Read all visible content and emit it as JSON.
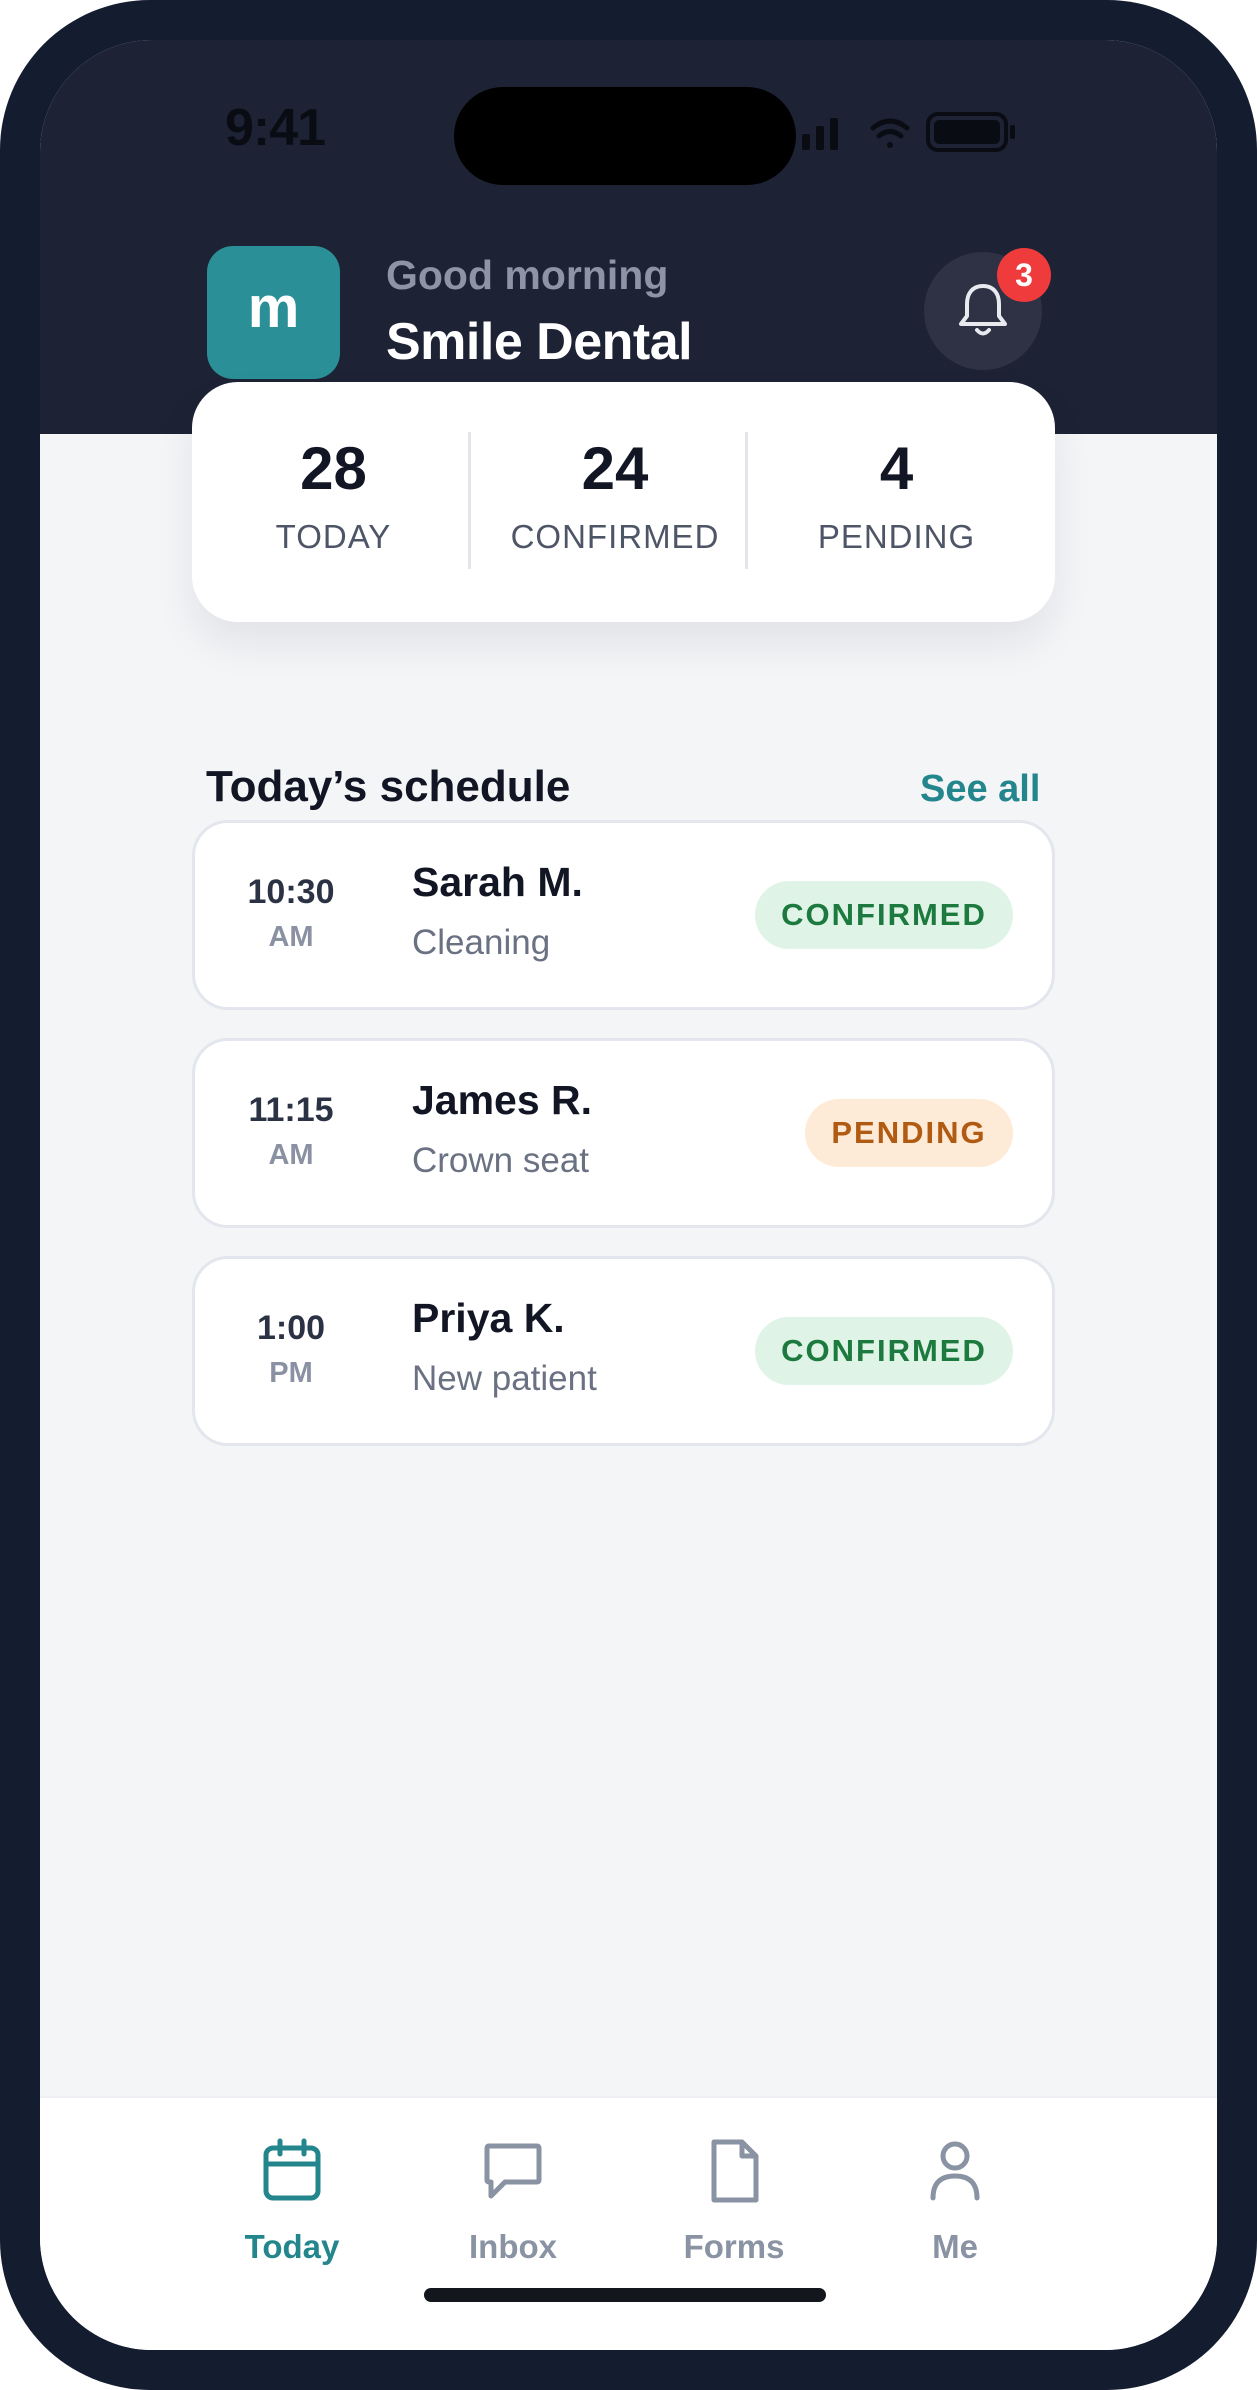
{
  "status_bar": {
    "time": "9:41"
  },
  "header": {
    "logo_letter": "m",
    "greeting": "Good morning",
    "practice_name": "Smile Dental",
    "notification_count": "3",
    "bell_icon": "bell-icon"
  },
  "stats": [
    {
      "value": "28",
      "label": "TODAY"
    },
    {
      "value": "24",
      "label": "CONFIRMED"
    },
    {
      "value": "4",
      "label": "PENDING"
    }
  ],
  "schedule": {
    "title": "Today’s schedule",
    "see_all": "See all",
    "appointments": [
      {
        "time": "10:30",
        "ampm": "AM",
        "name": "Sarah M.",
        "type": "Cleaning",
        "status": "CONFIRMED"
      },
      {
        "time": "11:15",
        "ampm": "AM",
        "name": "James R.",
        "type": "Crown seat",
        "status": "PENDING"
      },
      {
        "time": "1:00",
        "ampm": "PM",
        "name": "Priya K.",
        "type": "New patient",
        "status": "CONFIRMED"
      }
    ]
  },
  "tabs": [
    {
      "label": "Today",
      "icon": "calendar-icon",
      "active": true
    },
    {
      "label": "Inbox",
      "icon": "chat-icon",
      "active": false
    },
    {
      "label": "Forms",
      "icon": "document-icon",
      "active": false
    },
    {
      "label": "Me",
      "icon": "person-icon",
      "active": false
    }
  ],
  "colors": {
    "accent": "#24868d",
    "header_bg": "#1e2235",
    "confirmed_bg": "#dff3e7",
    "confirmed_text": "#1d7a3f",
    "pending_bg": "#fdebd8",
    "pending_text": "#b15a12",
    "notification_badge": "#ef3b3b"
  }
}
